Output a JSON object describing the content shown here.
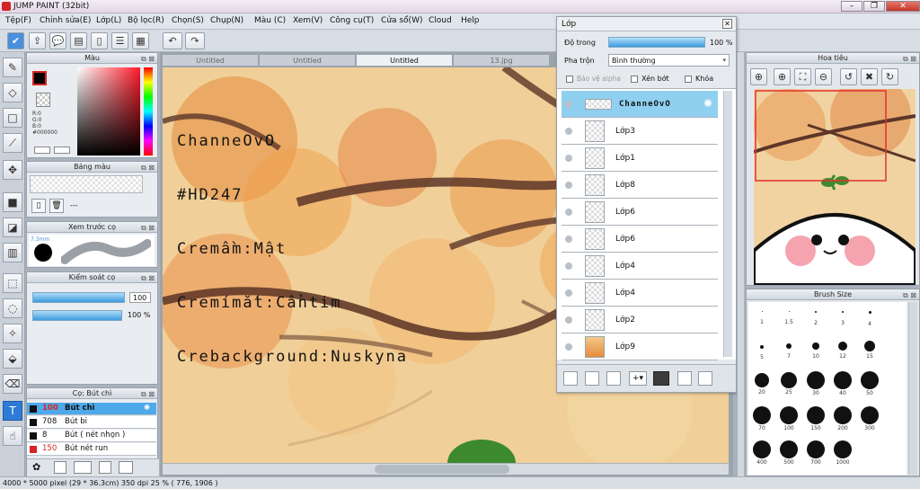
{
  "window": {
    "title": "JUMP PAINT (32bit)"
  },
  "menu": [
    "Tệp(F)",
    "Chỉnh sửa(E)",
    "Lớp(L)",
    "Bộ lọc(R)",
    "Chọn(S)",
    "Chụp(N)",
    "Màu (C)",
    "Xem(V)",
    "Công cụ(T)",
    "Cửa sổ(W)",
    "Cloud",
    "Help"
  ],
  "color_panel": {
    "title": "Màu",
    "r": "R:0",
    "g": "G:0",
    "b": "B:0",
    "hex": "#000000",
    "primary": "#000000",
    "accent": "#d42424"
  },
  "palette_panel": {
    "title": "Bảng màu",
    "value": "---"
  },
  "brush_preview_panel": {
    "title": "Xem trước cọ",
    "size": "7.3mm"
  },
  "brush_control_panel": {
    "title": "Kiểm soát cọ",
    "size_value": "100",
    "opacity_value": "100 %"
  },
  "brush_list_panel": {
    "title": "Cọ: Bút chì",
    "items": [
      {
        "size": "100",
        "name": "Bút chì"
      },
      {
        "size": "708",
        "name": "Bút bi"
      },
      {
        "size": "8",
        "name": "Bút ( nét nhọn )"
      },
      {
        "size": "150",
        "name": "Bút nét run"
      }
    ]
  },
  "tabs": [
    "Untitled",
    "Untitled",
    "Untitled",
    "13.jpg"
  ],
  "canvas_text": [
    "ChanneOvO",
    "#HD247",
    "Cremầm:Mật",
    "Cremímắt:Cẩntim",
    "Crebackground:Nuskyna"
  ],
  "layer_panel": {
    "title": "Lớp",
    "opacity_label": "Độ trong",
    "opacity_value": "100 %",
    "blend_label": "Pha trộn",
    "blend_value": "Bình thường",
    "protect_alpha": "Bảo vệ alpha",
    "clip": "Xén bớt",
    "lock": "Khóa",
    "layers": [
      "ChanneOvO",
      "Lớp3",
      "Lớp1",
      "Lớp8",
      "Lớp6",
      "Lớp6",
      "Lớp4",
      "Lớp4",
      "Lớp2",
      "Lớp9"
    ]
  },
  "navigator_panel": {
    "title": "Hoa tiêu"
  },
  "brush_size_panel": {
    "title": "Brush Size",
    "sizes": [
      "1",
      "1.5",
      "2",
      "3",
      "4",
      "5",
      "7",
      "10",
      "12",
      "15",
      "20",
      "25",
      "30",
      "40",
      "50",
      "70",
      "100",
      "150",
      "200",
      "300",
      "400",
      "500",
      "700",
      "1000"
    ]
  },
  "status": "4000 * 5000 pixel  (29 * 36.3cm)  350 dpi  25 %  ( 776, 1906 )"
}
